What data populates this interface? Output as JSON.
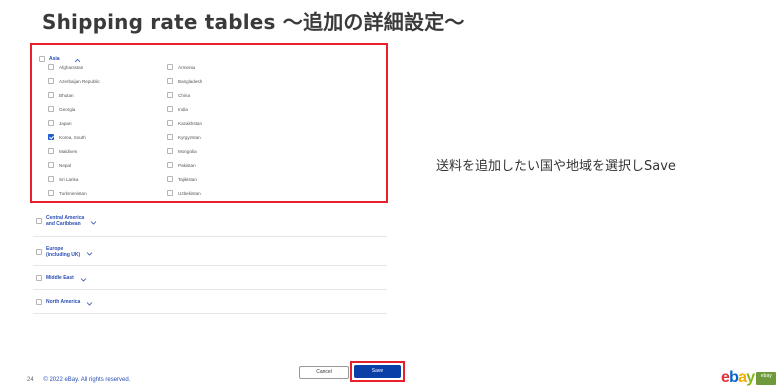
{
  "slide": {
    "title": "Shipping rate tables ～追加の詳細設定～",
    "annotation": "送料を追加したい国や地域を選択しSave",
    "page_number": "24",
    "copyright": "© 2022 eBay. All rights reserved."
  },
  "asia": {
    "label": "Asia",
    "expanded": true,
    "countries_left": [
      {
        "name": "Afghanistan",
        "checked": false
      },
      {
        "name": "Azerbaijan Republic",
        "checked": false
      },
      {
        "name": "Bhutan",
        "checked": false
      },
      {
        "name": "Georgia",
        "checked": false
      },
      {
        "name": "Japan",
        "checked": false
      },
      {
        "name": "Korea, South",
        "checked": true
      },
      {
        "name": "Maldives",
        "checked": false
      },
      {
        "name": "Nepal",
        "checked": false
      },
      {
        "name": "Sri Lanka",
        "checked": false
      },
      {
        "name": "Turkmenistan",
        "checked": false
      }
    ],
    "countries_right": [
      {
        "name": "Armenia",
        "checked": false
      },
      {
        "name": "Bangladesh",
        "checked": false
      },
      {
        "name": "China",
        "checked": false
      },
      {
        "name": "India",
        "checked": false
      },
      {
        "name": "Kazakhstan",
        "checked": false
      },
      {
        "name": "Kyrgyzstan",
        "checked": false
      },
      {
        "name": "Mongolia",
        "checked": false
      },
      {
        "name": "Pakistan",
        "checked": false
      },
      {
        "name": "Tajikistan",
        "checked": false
      },
      {
        "name": "Uzbekistan",
        "checked": false
      }
    ]
  },
  "regions": [
    {
      "line1": "Central America",
      "line2": "and Caribbean"
    },
    {
      "line1": "Europe",
      "line2": "(including UK)"
    },
    {
      "line1": "Middle East",
      "line2": ""
    },
    {
      "line1": "North America",
      "line2": ""
    }
  ],
  "buttons": {
    "cancel": "Cancel",
    "save": "Save"
  },
  "logo": {
    "text": "ebay",
    "badge": "ebay"
  },
  "colors": {
    "highlight_border": "#e8202a",
    "link_blue": "#2b4fb5",
    "save_button": "#0b3fa8",
    "checkbox_checked": "#1f5cd1"
  }
}
